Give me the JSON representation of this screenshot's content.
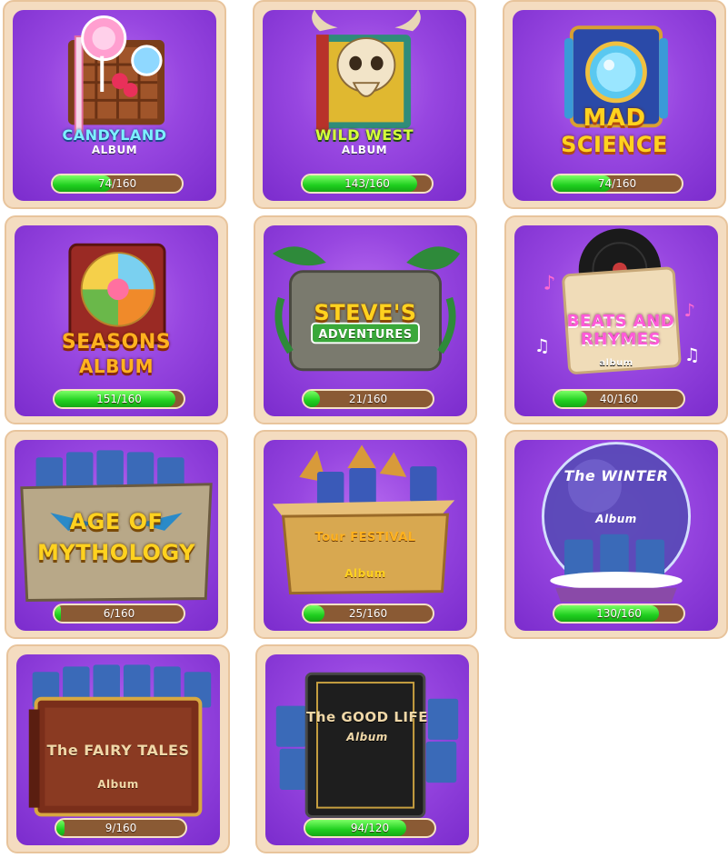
{
  "albums": [
    {
      "name": "CANDYLAND",
      "subtitle": "ALBUM",
      "progress": "74/160",
      "collected": 74,
      "total": 160,
      "icon": "candy-book-icon"
    },
    {
      "name": "WILD WEST",
      "subtitle": "ALBUM",
      "progress": "143/160",
      "collected": 143,
      "total": 160,
      "icon": "bull-skull-book-icon"
    },
    {
      "name": "MAD",
      "subtitle": "SCIENCE",
      "progress": "74/160",
      "collected": 74,
      "total": 160,
      "icon": "science-machine-icon"
    },
    {
      "name": "SEASONS",
      "subtitle": "ALBUM",
      "progress": "151/160",
      "collected": 151,
      "total": 160,
      "icon": "seasons-book-icon"
    },
    {
      "name": "STEVE'S",
      "subtitle": "ADVENTURES",
      "progress": "21/160",
      "collected": 21,
      "total": 160,
      "icon": "jungle-ruins-icon"
    },
    {
      "name": "BEATS AND RHYMES",
      "subtitle": "album",
      "progress": "40/160",
      "collected": 40,
      "total": 160,
      "icon": "vinyl-record-icon"
    },
    {
      "name": "AGE OF",
      "subtitle": "MYTHOLOGY",
      "progress": "6/160",
      "collected": 6,
      "total": 160,
      "icon": "stone-tablet-icon"
    },
    {
      "name": "Tour FESTIVAL",
      "subtitle": "Album",
      "progress": "25/160",
      "collected": 25,
      "total": 160,
      "icon": "festival-box-icon"
    },
    {
      "name": "The WINTER",
      "subtitle": "Album",
      "progress": "130/160",
      "collected": 130,
      "total": 160,
      "icon": "snow-globe-icon"
    },
    {
      "name": "The FAIRY TALES",
      "subtitle": "Album",
      "progress": "9/160",
      "collected": 9,
      "total": 160,
      "icon": "fairy-book-icon"
    },
    {
      "name": "The GOOD LIFE",
      "subtitle": "Album",
      "progress": "94/120",
      "collected": 94,
      "total": 120,
      "icon": "black-book-icon"
    }
  ],
  "colors": {
    "card_bg": "#f4dcc0",
    "panel_purple": "#9746e0",
    "bar_bg": "#8a5a34",
    "bar_fill": "#1fcf1f"
  }
}
